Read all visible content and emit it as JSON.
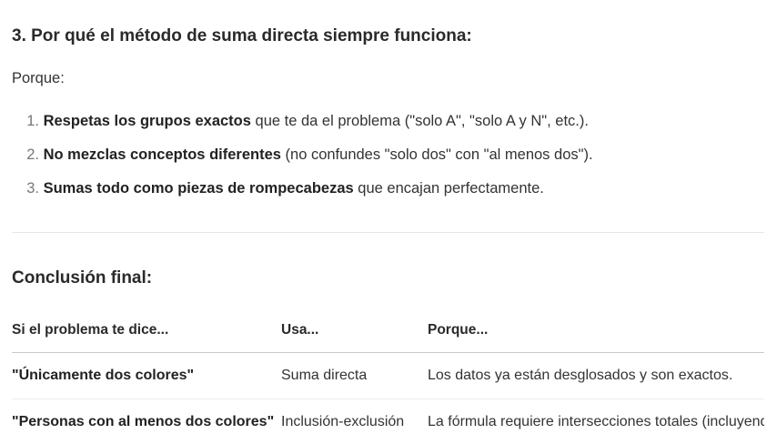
{
  "section": {
    "heading": "3. Por qué el método de suma directa siempre funciona:",
    "intro": "Porque:",
    "reasons": [
      {
        "num": "1.",
        "bold": "Respetas los grupos exactos",
        "rest": " que te da el problema (\"solo A\", \"solo A y N\", etc.)."
      },
      {
        "num": "2.",
        "bold": "No mezclas conceptos diferentes",
        "rest": " (no confundes \"solo dos\" con \"al menos dos\")."
      },
      {
        "num": "3.",
        "bold": "Sumas todo como piezas de rompecabezas",
        "rest": " que encajan perfectamente."
      }
    ]
  },
  "conclusion": {
    "heading": "Conclusión final:",
    "table": {
      "headers": [
        "Si el problema te dice...",
        "Usa...",
        "Porque..."
      ],
      "rows": [
        [
          "\"Únicamente dos colores\"",
          "Suma directa",
          "Los datos ya están desglosados y son exactos."
        ],
        [
          "\"Personas con al menos dos colores\"",
          "Inclusión-exclusión",
          "La fórmula requiere intersecciones totales (incluyendo"
        ]
      ]
    }
  }
}
